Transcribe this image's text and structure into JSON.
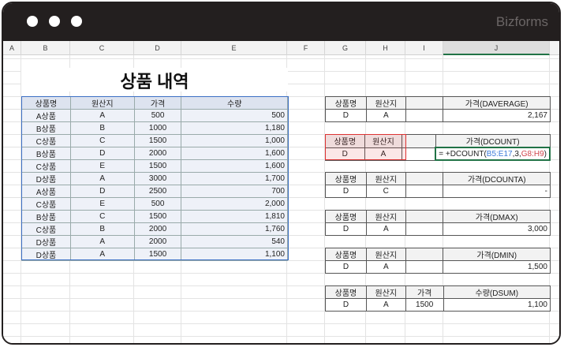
{
  "window": {
    "brand": "Bizforms"
  },
  "columns": [
    "A",
    "B",
    "C",
    "D",
    "E",
    "F",
    "G",
    "H",
    "I",
    "J"
  ],
  "title": "상품 내역",
  "main_table": {
    "headers": [
      "상품명",
      "원산지",
      "가격",
      "수량"
    ],
    "rows": [
      [
        "A상품",
        "A",
        "500",
        "500"
      ],
      [
        "B상품",
        "B",
        "1000",
        "1,180"
      ],
      [
        "C상품",
        "C",
        "1500",
        "1,000"
      ],
      [
        "B상품",
        "D",
        "2000",
        "1,600"
      ],
      [
        "C상품",
        "E",
        "1500",
        "1,600"
      ],
      [
        "D상품",
        "A",
        "3000",
        "1,700"
      ],
      [
        "A상품",
        "D",
        "2500",
        "700"
      ],
      [
        "C상품",
        "E",
        "500",
        "2,000"
      ],
      [
        "B상품",
        "C",
        "1500",
        "1,810"
      ],
      [
        "C상품",
        "B",
        "2000",
        "1,760"
      ],
      [
        "D상품",
        "A",
        "2000",
        "540"
      ],
      [
        "D상품",
        "A",
        "1500",
        "1,100"
      ]
    ]
  },
  "criteria_tables": [
    {
      "h": [
        "상품명",
        "원산지",
        "",
        "가격(DAVERAGE)"
      ],
      "d": [
        "D",
        "A",
        "",
        "2,167"
      ]
    },
    {
      "h": [
        "상품명",
        "원산지",
        "",
        "가격(DCOUNT)"
      ],
      "d": [
        "D",
        "A",
        "",
        ""
      ],
      "formula": {
        "prefix": "= +DCOUNT(",
        "range": "B5:E17",
        "mid": ",3,",
        "crit": "G8:H9",
        "suffix": ")"
      }
    },
    {
      "h": [
        "상품명",
        "원산지",
        "",
        "가격(DCOUNTA)"
      ],
      "d": [
        "D",
        "C",
        "",
        "-"
      ]
    },
    {
      "h": [
        "상품명",
        "원산지",
        "",
        "가격(DMAX)"
      ],
      "d": [
        "D",
        "A",
        "",
        "3,000"
      ]
    },
    {
      "h": [
        "상품명",
        "원산지",
        "",
        "가격(DMIN)"
      ],
      "d": [
        "D",
        "A",
        "",
        "1,500"
      ]
    },
    {
      "h": [
        "상품명",
        "원산지",
        "가격",
        "수량(DSUM)"
      ],
      "d": [
        "D",
        "A",
        "1500",
        "1,100"
      ]
    }
  ]
}
